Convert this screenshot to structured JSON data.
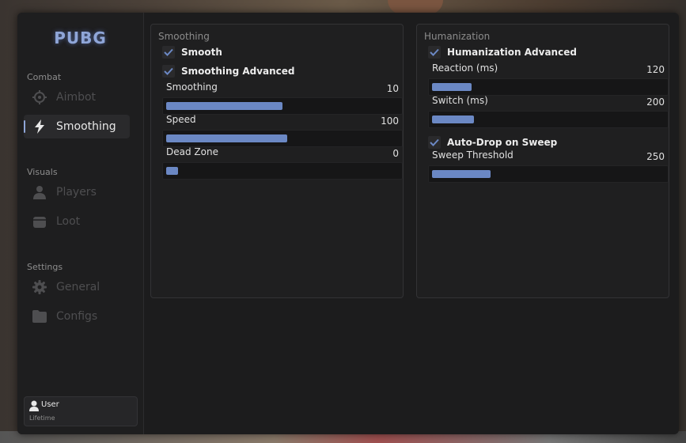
{
  "app": {
    "logo_text": "PUBG"
  },
  "colors": {
    "accent": "#6b88c4",
    "logo": "#8fa6d8",
    "text_muted": "#8c8c8c",
    "panel_bg": "#1f1f20"
  },
  "sidebar": {
    "sections": [
      {
        "label": "Combat",
        "items": [
          {
            "label": "Aimbot",
            "icon": "crosshair-icon",
            "active": false
          },
          {
            "label": "Smoothing",
            "icon": "lightning-icon",
            "active": true
          }
        ]
      },
      {
        "label": "Visuals",
        "items": [
          {
            "label": "Players",
            "icon": "person-icon",
            "active": false
          },
          {
            "label": "Loot",
            "icon": "box-icon",
            "active": false
          }
        ]
      },
      {
        "label": "Settings",
        "items": [
          {
            "label": "General",
            "icon": "gear-icon",
            "active": false
          },
          {
            "label": "Configs",
            "icon": "folder-icon",
            "active": false
          }
        ]
      }
    ],
    "user": {
      "name": "User",
      "license": "Lifetime"
    }
  },
  "panels": {
    "smoothing": {
      "title": "Smoothing",
      "checkboxes": [
        {
          "label": "Smooth",
          "checked": true
        },
        {
          "label": "Smoothing Advanced",
          "checked": true
        }
      ],
      "sliders": [
        {
          "label": "Smoothing",
          "value": "10",
          "fill_fraction": 0.5
        },
        {
          "label": "Speed",
          "value": "100",
          "fill_fraction": 0.52
        },
        {
          "label": "Dead Zone",
          "value": "0",
          "fill_fraction": 0.05
        }
      ]
    },
    "humanization": {
      "title": "Humanization",
      "checkboxes": [
        {
          "label": "Humanization Advanced",
          "checked": true
        },
        {
          "label": "Auto-Drop on Sweep",
          "checked": true
        }
      ],
      "sliders": [
        {
          "label": "Reaction (ms)",
          "value": "120",
          "fill_fraction": 0.17
        },
        {
          "label": "Switch (ms)",
          "value": "200",
          "fill_fraction": 0.18
        },
        {
          "label": "Sweep Threshold",
          "value": "250",
          "fill_fraction": 0.25
        }
      ]
    }
  }
}
